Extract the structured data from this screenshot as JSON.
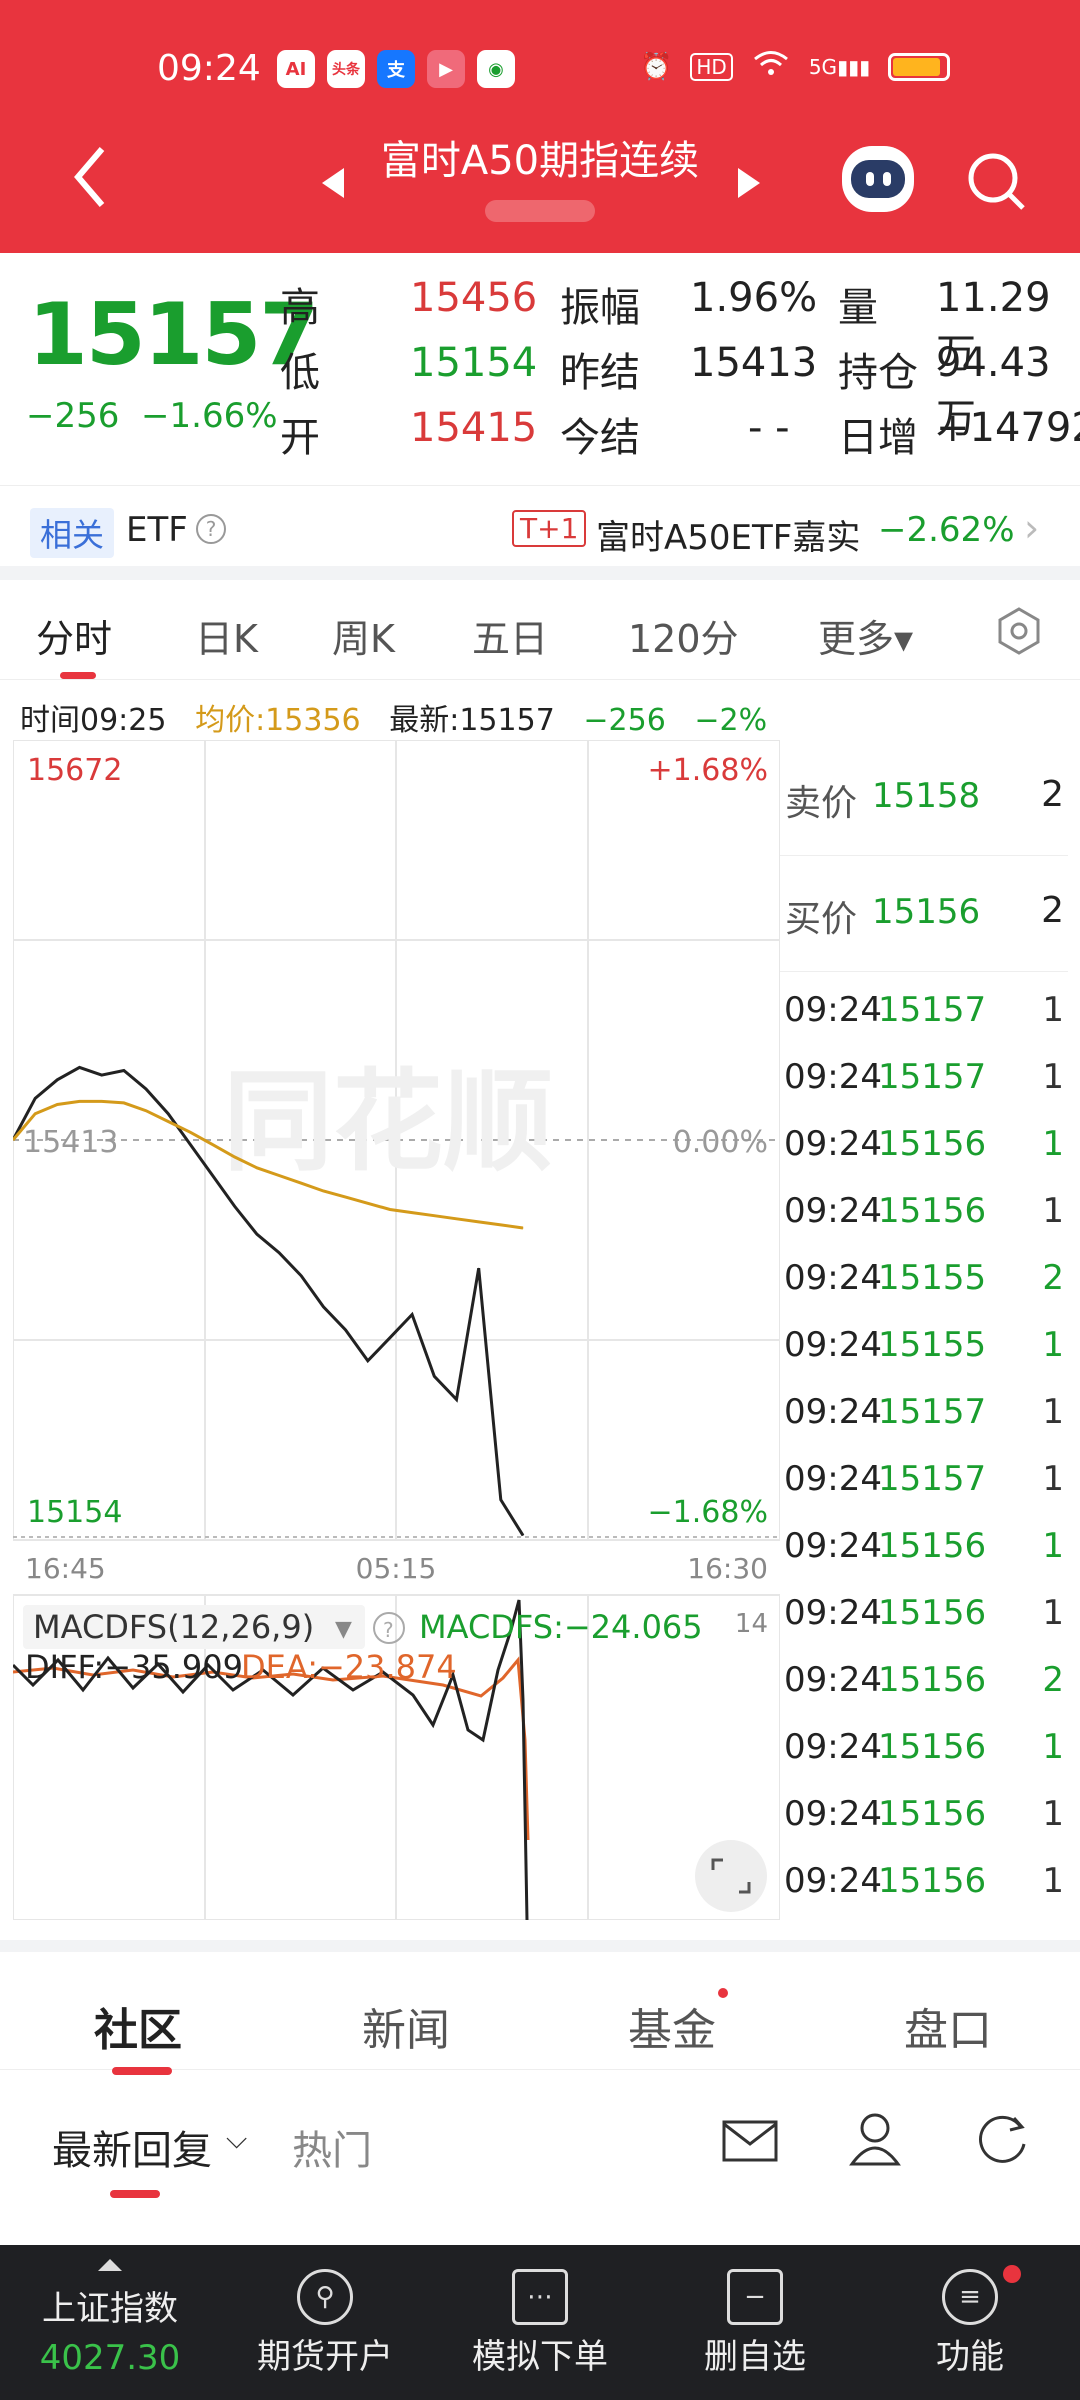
{
  "status_bar": {
    "time": "09:24",
    "apps": [
      "AI",
      "头条",
      "支",
      "▶",
      "◉"
    ],
    "icons": [
      "alarm-icon",
      "hd-icon",
      "wifi-icon",
      "signal-icon"
    ],
    "net": "5G",
    "battery_level": 0.9
  },
  "header": {
    "title": "富时A50期指连续",
    "back_icon": "chevron-left-icon",
    "prev_icon": "triangle-left-icon",
    "next_icon": "triangle-right-icon",
    "robot_icon": "robot-icon",
    "search_icon": "search-icon"
  },
  "quote": {
    "price": "15157",
    "change": "−256",
    "change_pct": "−1.66%",
    "high_label": "高",
    "high": "15456",
    "low_label": "低",
    "low": "15154",
    "open_label": "开",
    "open": "15415",
    "amp_label": "振幅",
    "amp": "1.96%",
    "prev_label": "昨结",
    "prev": "15413",
    "today_label": "今结",
    "today": "- -",
    "vol_label": "量",
    "vol": "11.29万",
    "oi_label": "持仓",
    "oi": "94.43万",
    "inc_label": "日增",
    "inc": "+14792"
  },
  "etf": {
    "tag": "相关",
    "label": "ETF",
    "badge": "T+1",
    "name": "富时A50ETF嘉实",
    "pct": "−2.62%"
  },
  "tabs": [
    "分时",
    "日K",
    "周K",
    "五日",
    "120分",
    "更多▾"
  ],
  "info": {
    "time": "时间09:25",
    "avg": "均价:15356",
    "latest": "最新:15157",
    "chg": "−256",
    "pct": "−2%"
  },
  "chart": {
    "y_max": "15672",
    "y_max_pct": "+1.68%",
    "y_ref": "15413",
    "y_ref_pct": "0.00%",
    "y_min": "15154",
    "y_min_pct": "−1.68%",
    "x_labels": [
      "16:45",
      "05:15",
      "16:30"
    ],
    "watermark": "同花顺",
    "macd_name": "MACDFS(12,26,9)",
    "macd_val": "MACDFS:−24.065",
    "macd_top": "14",
    "diff": "DIFF:−35.909",
    "dea": "DEA:−23.874"
  },
  "chart_data": {
    "type": "line",
    "series": [
      {
        "name": "最新",
        "values": [
          15413,
          15440,
          15452,
          15460,
          15455,
          15458,
          15446,
          15430,
          15410,
          15390,
          15370,
          15352,
          15340,
          15325,
          15305,
          15290,
          15270,
          15285,
          15300,
          15260,
          15245,
          15330,
          15180,
          15157
        ]
      },
      {
        "name": "均价",
        "values": [
          15413,
          15430,
          15436,
          15438,
          15438,
          15437,
          15432,
          15425,
          15418,
          15410,
          15402,
          15395,
          15390,
          15385,
          15380,
          15376,
          15372,
          15368,
          15366,
          15364,
          15362,
          15360,
          15358,
          15356
        ]
      }
    ],
    "ylim": [
      15154,
      15672
    ]
  },
  "orderbook": {
    "ask_label": "卖价",
    "ask": "15158",
    "ask_vol": "2",
    "bid_label": "买价",
    "bid": "15156",
    "bid_vol": "2",
    "trades": [
      [
        "09:24",
        "15157",
        "1"
      ],
      [
        "09:24",
        "15157",
        "1"
      ],
      [
        "09:24",
        "15156",
        "1"
      ],
      [
        "09:24",
        "15156",
        "1"
      ],
      [
        "09:24",
        "15155",
        "2"
      ],
      [
        "09:24",
        "15155",
        "1"
      ],
      [
        "09:24",
        "15157",
        "1"
      ],
      [
        "09:24",
        "15157",
        "1"
      ],
      [
        "09:24",
        "15156",
        "1"
      ],
      [
        "09:24",
        "15156",
        "1"
      ],
      [
        "09:24",
        "15156",
        "2"
      ],
      [
        "09:24",
        "15156",
        "1"
      ],
      [
        "09:24",
        "15156",
        "1"
      ],
      [
        "09:24",
        "15156",
        "1"
      ]
    ]
  },
  "content_tabs": [
    "社区",
    "新闻",
    "基金",
    "盘口"
  ],
  "sub": {
    "latest": "最新回复",
    "hot": "热门"
  },
  "bottom": {
    "index_name": "上证指数",
    "index_value": "4027.30",
    "items": [
      "期货开户",
      "模拟下单",
      "删自选",
      "功能"
    ]
  }
}
